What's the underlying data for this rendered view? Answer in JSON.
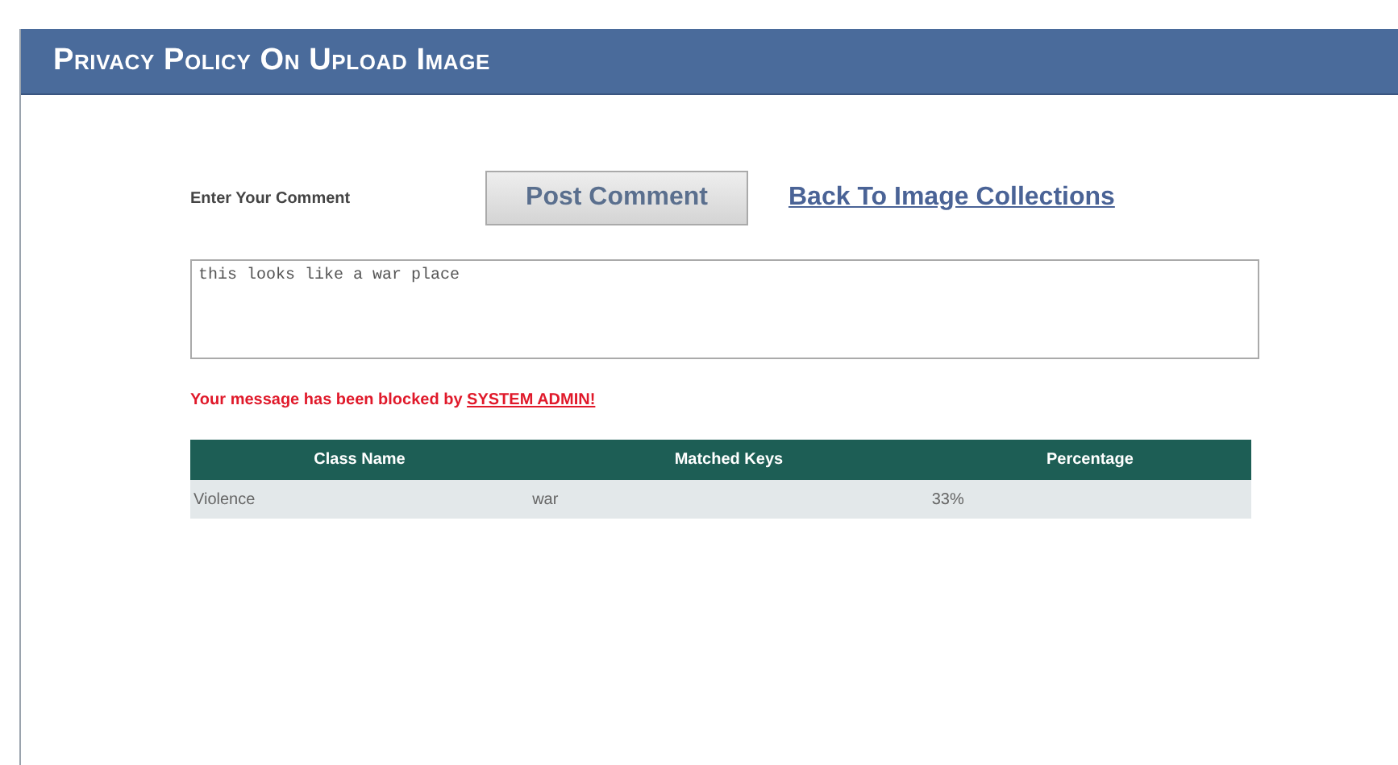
{
  "header": {
    "title": "Privacy Policy On Upload Image"
  },
  "comment": {
    "label": "Enter Your Comment",
    "button": "Post Comment",
    "link": "Back To Image Collections",
    "value": "this looks like a war place"
  },
  "message": {
    "text": "Your message has been blocked by ",
    "link": "SYSTEM ADMIN!"
  },
  "table": {
    "columns": [
      "Class Name",
      "Matched Keys",
      "Percentage"
    ],
    "rows": [
      [
        "Violence",
        "war",
        "33%"
      ]
    ]
  }
}
